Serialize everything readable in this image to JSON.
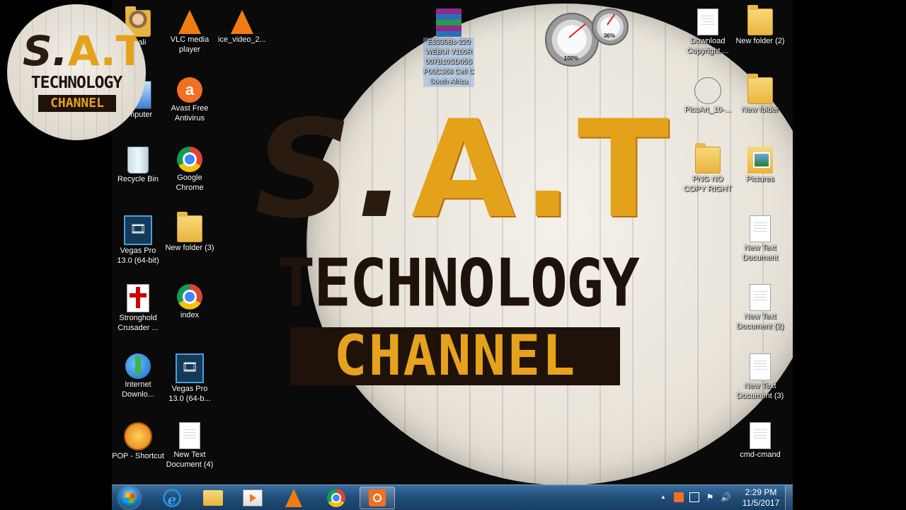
{
  "watermark": {
    "line1_s": "S.",
    "line1_at": "A.T",
    "line2": "TECHNOLOGY",
    "line3": "CHANNEL"
  },
  "wallpaper": {
    "line1_s": "S.",
    "line1_at": "A.T",
    "line2": "TECHNOLOGY",
    "line3": "CHANNEL"
  },
  "icons": {
    "admin": "ib ali",
    "computer": "omputer",
    "recycle_bin": "Recycle Bin",
    "vegas_pro_1": "Vegas Pro 13.0 (64-bit)",
    "stronghold": "Stronghold Crusader ...",
    "idm": "Internet Downlo...",
    "pop": "POP - Shortcut",
    "vlc": "VLC media player",
    "avast": "Avast Free Antivirus",
    "chrome": "Google Chrome",
    "new_folder_3": "New folder (3)",
    "index": "index",
    "vegas_pro_2": "Vegas Pro 13.0 (64-b...",
    "new_text_doc_4": "New Text Document (4)",
    "ice_video": "ice_video_2...",
    "winrar_file": "E5330Bs-220 WEBUI V100R 007B10SD05S P00C368 Cell C South Africa",
    "download_copyright": "Download Copyright ...",
    "picsart": "PicsArt_10-...",
    "png_no_copyright": "PNG NO COPY RIGHT",
    "new_folder_2": "New folder (2)",
    "new_folder": "New folder",
    "pictures": "Pictures",
    "new_text_doc": "New Text Document",
    "new_text_doc_2": "New Text Document (2)",
    "new_text_doc_3": "New Text Document (3)",
    "cmd": "cmd-cmand"
  },
  "icon_glyphs": {
    "avast": "a",
    "vegas": "🎞"
  },
  "gadget": {
    "cpu": "100%",
    "memory": "36%"
  },
  "taskbar": {
    "pinned": [
      "internet-explorer-icon",
      "windows-explorer-icon",
      "media-player-icon",
      "vlc-icon",
      "chrome-icon",
      "recorder-icon"
    ],
    "ie_glyph": "e"
  },
  "tray": {
    "arrow": "▲",
    "flag": "⚑",
    "speaker": "🔊",
    "time": "2:29 PM",
    "date": "11/5/2017"
  },
  "colors": {
    "taskbar": "#214f7b",
    "accent_orange": "#e3a21a",
    "dark_brown": "#1e120a"
  }
}
